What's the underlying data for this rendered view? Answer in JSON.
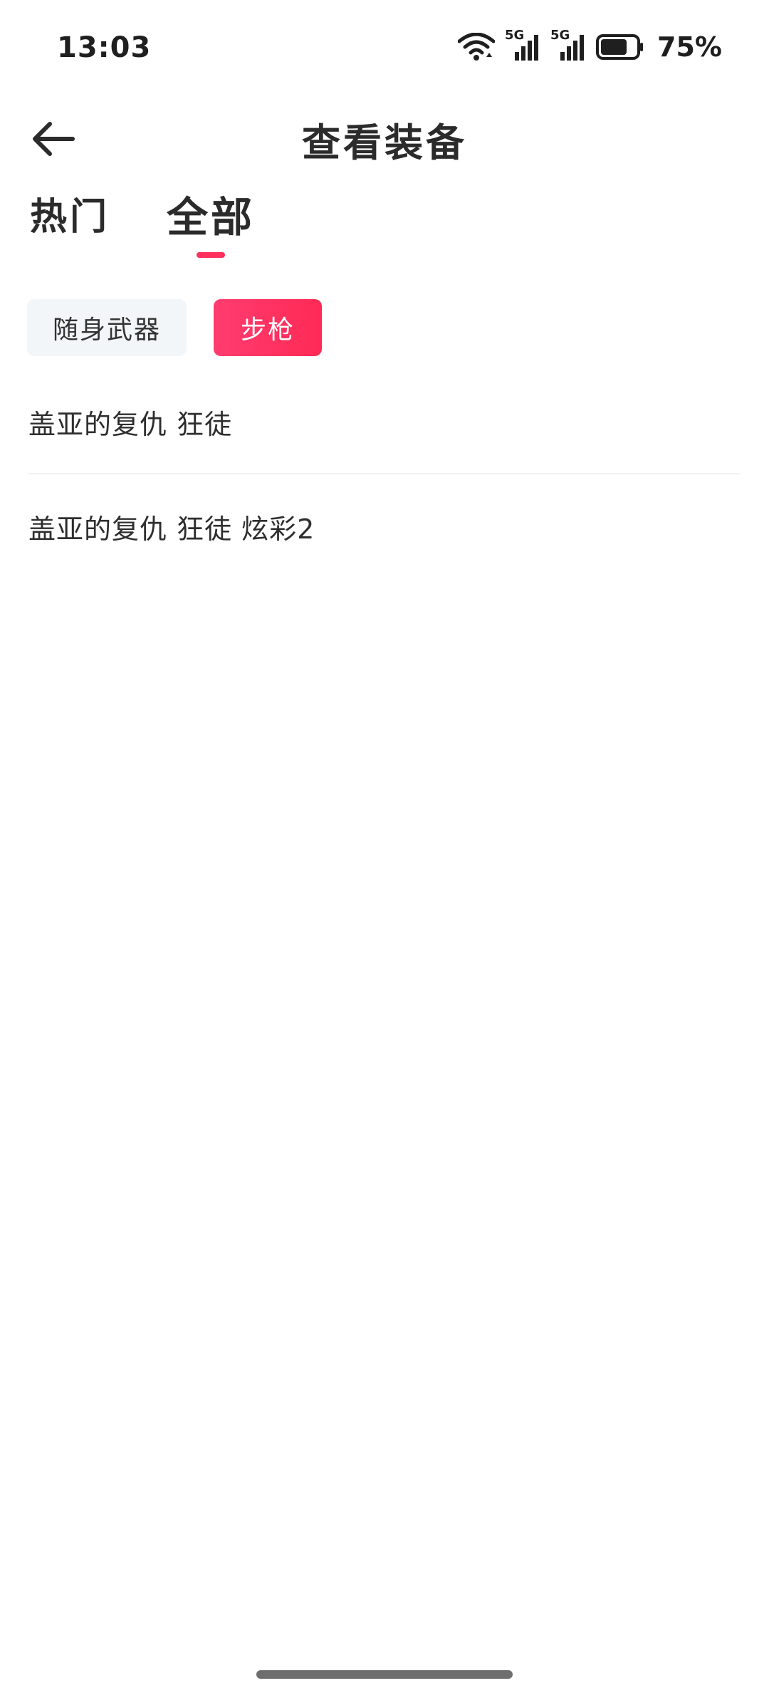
{
  "status_bar": {
    "time": "13:03",
    "battery_percent": "75%",
    "battery_level": 0.75,
    "network_1": "5G",
    "network_2": "5G",
    "icons": [
      "wifi-icon",
      "signal-5g-icon",
      "signal-5g-icon",
      "battery-icon"
    ]
  },
  "header": {
    "title": "查看装备",
    "back_icon": "arrow-left-icon"
  },
  "tabs": [
    {
      "label": "热门",
      "active": false
    },
    {
      "label": "全部",
      "active": true
    }
  ],
  "filters": [
    {
      "label": "随身武器",
      "selected": false
    },
    {
      "label": "步枪",
      "selected": true
    }
  ],
  "items": [
    {
      "name": "盖亚的复仇 狂徒"
    },
    {
      "name": "盖亚的复仇 狂徒 炫彩2"
    }
  ],
  "colors": {
    "accent": "#ff2f5e",
    "chip_inactive_bg": "#f3f6f8",
    "text_primary": "#2b2b2b"
  }
}
